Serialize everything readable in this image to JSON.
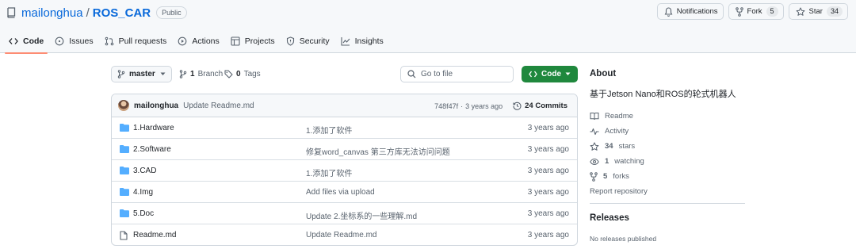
{
  "repo": {
    "owner": "mailonghua",
    "separator": "/",
    "name": "ROS_CAR",
    "visibility": "Public"
  },
  "header_buttons": {
    "notifications_label": "Notifications",
    "fork_label": "Fork",
    "fork_count": "5",
    "star_label": "Star",
    "star_count": "34"
  },
  "tabs": [
    {
      "label": "Code",
      "icon": "code-icon",
      "active": true
    },
    {
      "label": "Issues",
      "icon": "issue-icon"
    },
    {
      "label": "Pull requests",
      "icon": "pull-request-icon"
    },
    {
      "label": "Actions",
      "icon": "play-icon"
    },
    {
      "label": "Projects",
      "icon": "table-icon"
    },
    {
      "label": "Security",
      "icon": "shield-icon"
    },
    {
      "label": "Insights",
      "icon": "graph-icon"
    }
  ],
  "filenav": {
    "branch": "master",
    "branches_count": "1",
    "branches_label": "Branch",
    "tags_count": "0",
    "tags_label": "Tags",
    "goto_placeholder": "Go to file",
    "code_button": "Code"
  },
  "latest_commit": {
    "author": "mailonghua",
    "message": "Update Readme.md",
    "hash": "748f47f",
    "dot": "·",
    "time": "3 years ago",
    "commits_count": "24 Commits"
  },
  "files": [
    {
      "type": "dir",
      "name": "1.Hardware",
      "commit": "1.添加了软件",
      "date": "3 years ago"
    },
    {
      "type": "dir",
      "name": "2.Software",
      "commit": "修复word_canvas 第三方库无法访问问题",
      "date": "3 years ago"
    },
    {
      "type": "dir",
      "name": "3.CAD",
      "commit": "1.添加了软件",
      "date": "3 years ago"
    },
    {
      "type": "dir",
      "name": "4.Img",
      "commit": "Add files via upload",
      "date": "3 years ago"
    },
    {
      "type": "dir",
      "name": "5.Doc",
      "commit": "Update 2.坐标系的一些理解.md",
      "date": "3 years ago"
    },
    {
      "type": "file",
      "name": "Readme.md",
      "commit": "Update Readme.md",
      "date": "3 years ago"
    }
  ],
  "about": {
    "title": "About",
    "description": "基于Jetson Nano和ROS的轮式机器人",
    "readme": "Readme",
    "activity": "Activity",
    "stars_count": "34",
    "stars_label": "stars",
    "watching_count": "1",
    "watching_label": "watching",
    "forks_count": "5",
    "forks_label": "forks",
    "report": "Report repository"
  },
  "releases": {
    "title": "Releases",
    "empty": "No releases published"
  },
  "colors": {
    "accent_link": "#0969da",
    "code_button": "#1f883d",
    "folder": "#54aeff",
    "active_tab_underline": "#fd8c73"
  }
}
